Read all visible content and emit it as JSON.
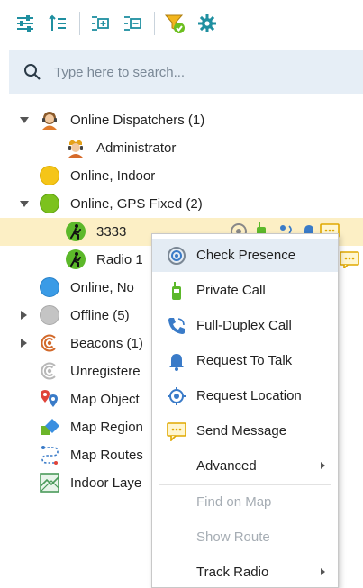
{
  "toolbar": {
    "buttons": [
      {
        "icon": "filter-sliders-icon"
      },
      {
        "icon": "sort-list-icon"
      },
      {
        "icon": "expand-all-icon"
      },
      {
        "icon": "collapse-all-icon"
      },
      {
        "icon": "funnel-check-icon"
      },
      {
        "icon": "gear-icon"
      }
    ]
  },
  "search": {
    "placeholder": "Type here to search..."
  },
  "tree": {
    "rows": [
      {
        "label": "Online Dispatchers (1)",
        "icon": "dispatcher-avatar-icon",
        "expanded": true
      },
      {
        "label": "Administrator",
        "icon": "administrator-avatar-icon"
      },
      {
        "label": "Online, Indoor",
        "icon": "yellow-status-dot-icon",
        "color": "#f5c518"
      },
      {
        "label": "Online, GPS Fixed (2)",
        "icon": "green-status-dot-icon",
        "color": "#7cc21e",
        "expanded": true
      },
      {
        "label": "3333",
        "icon": "walking-person-icon",
        "selected": true
      },
      {
        "label": "Radio 1",
        "icon": "walking-person-icon"
      },
      {
        "label": "Online, No",
        "icon": "blue-status-dot-icon",
        "color": "#3a9be6"
      },
      {
        "label": "Offline (5)",
        "icon": "gray-status-dot-icon",
        "color": "#bdbdbd",
        "expanded": false
      },
      {
        "label": "Beacons (1)",
        "icon": "beacon-icon",
        "expanded": false
      },
      {
        "label": "Unregistere",
        "icon": "unregistered-beacon-icon"
      },
      {
        "label": "Map Object",
        "icon": "map-pins-icon"
      },
      {
        "label": "Map Region",
        "icon": "map-region-icon"
      },
      {
        "label": "Map Routes",
        "icon": "map-route-icon"
      },
      {
        "label": "Indoor Laye",
        "icon": "indoor-layer-icon"
      }
    ]
  },
  "context_menu": {
    "items": [
      {
        "label": "Check Presence",
        "icon": "presence-icon",
        "hover": true
      },
      {
        "label": "Private Call",
        "icon": "radio-handset-icon"
      },
      {
        "label": "Full-Duplex Call",
        "icon": "phone-icon"
      },
      {
        "label": "Request To Talk",
        "icon": "bell-icon"
      },
      {
        "label": "Request Location",
        "icon": "location-target-icon"
      },
      {
        "label": "Send Message",
        "icon": "message-icon"
      },
      {
        "label": "Advanced",
        "submenu": true
      },
      {
        "label": "Find on Map",
        "disabled": true
      },
      {
        "label": "Show Route",
        "disabled": true
      },
      {
        "label": "Track Radio",
        "submenu": true
      }
    ]
  },
  "colors": {
    "toolbar_icon": "#1f8fa0",
    "selected_row": "#fcefc5",
    "menu_hover": "#e4ecf4",
    "search_bg": "#e6eef6"
  }
}
